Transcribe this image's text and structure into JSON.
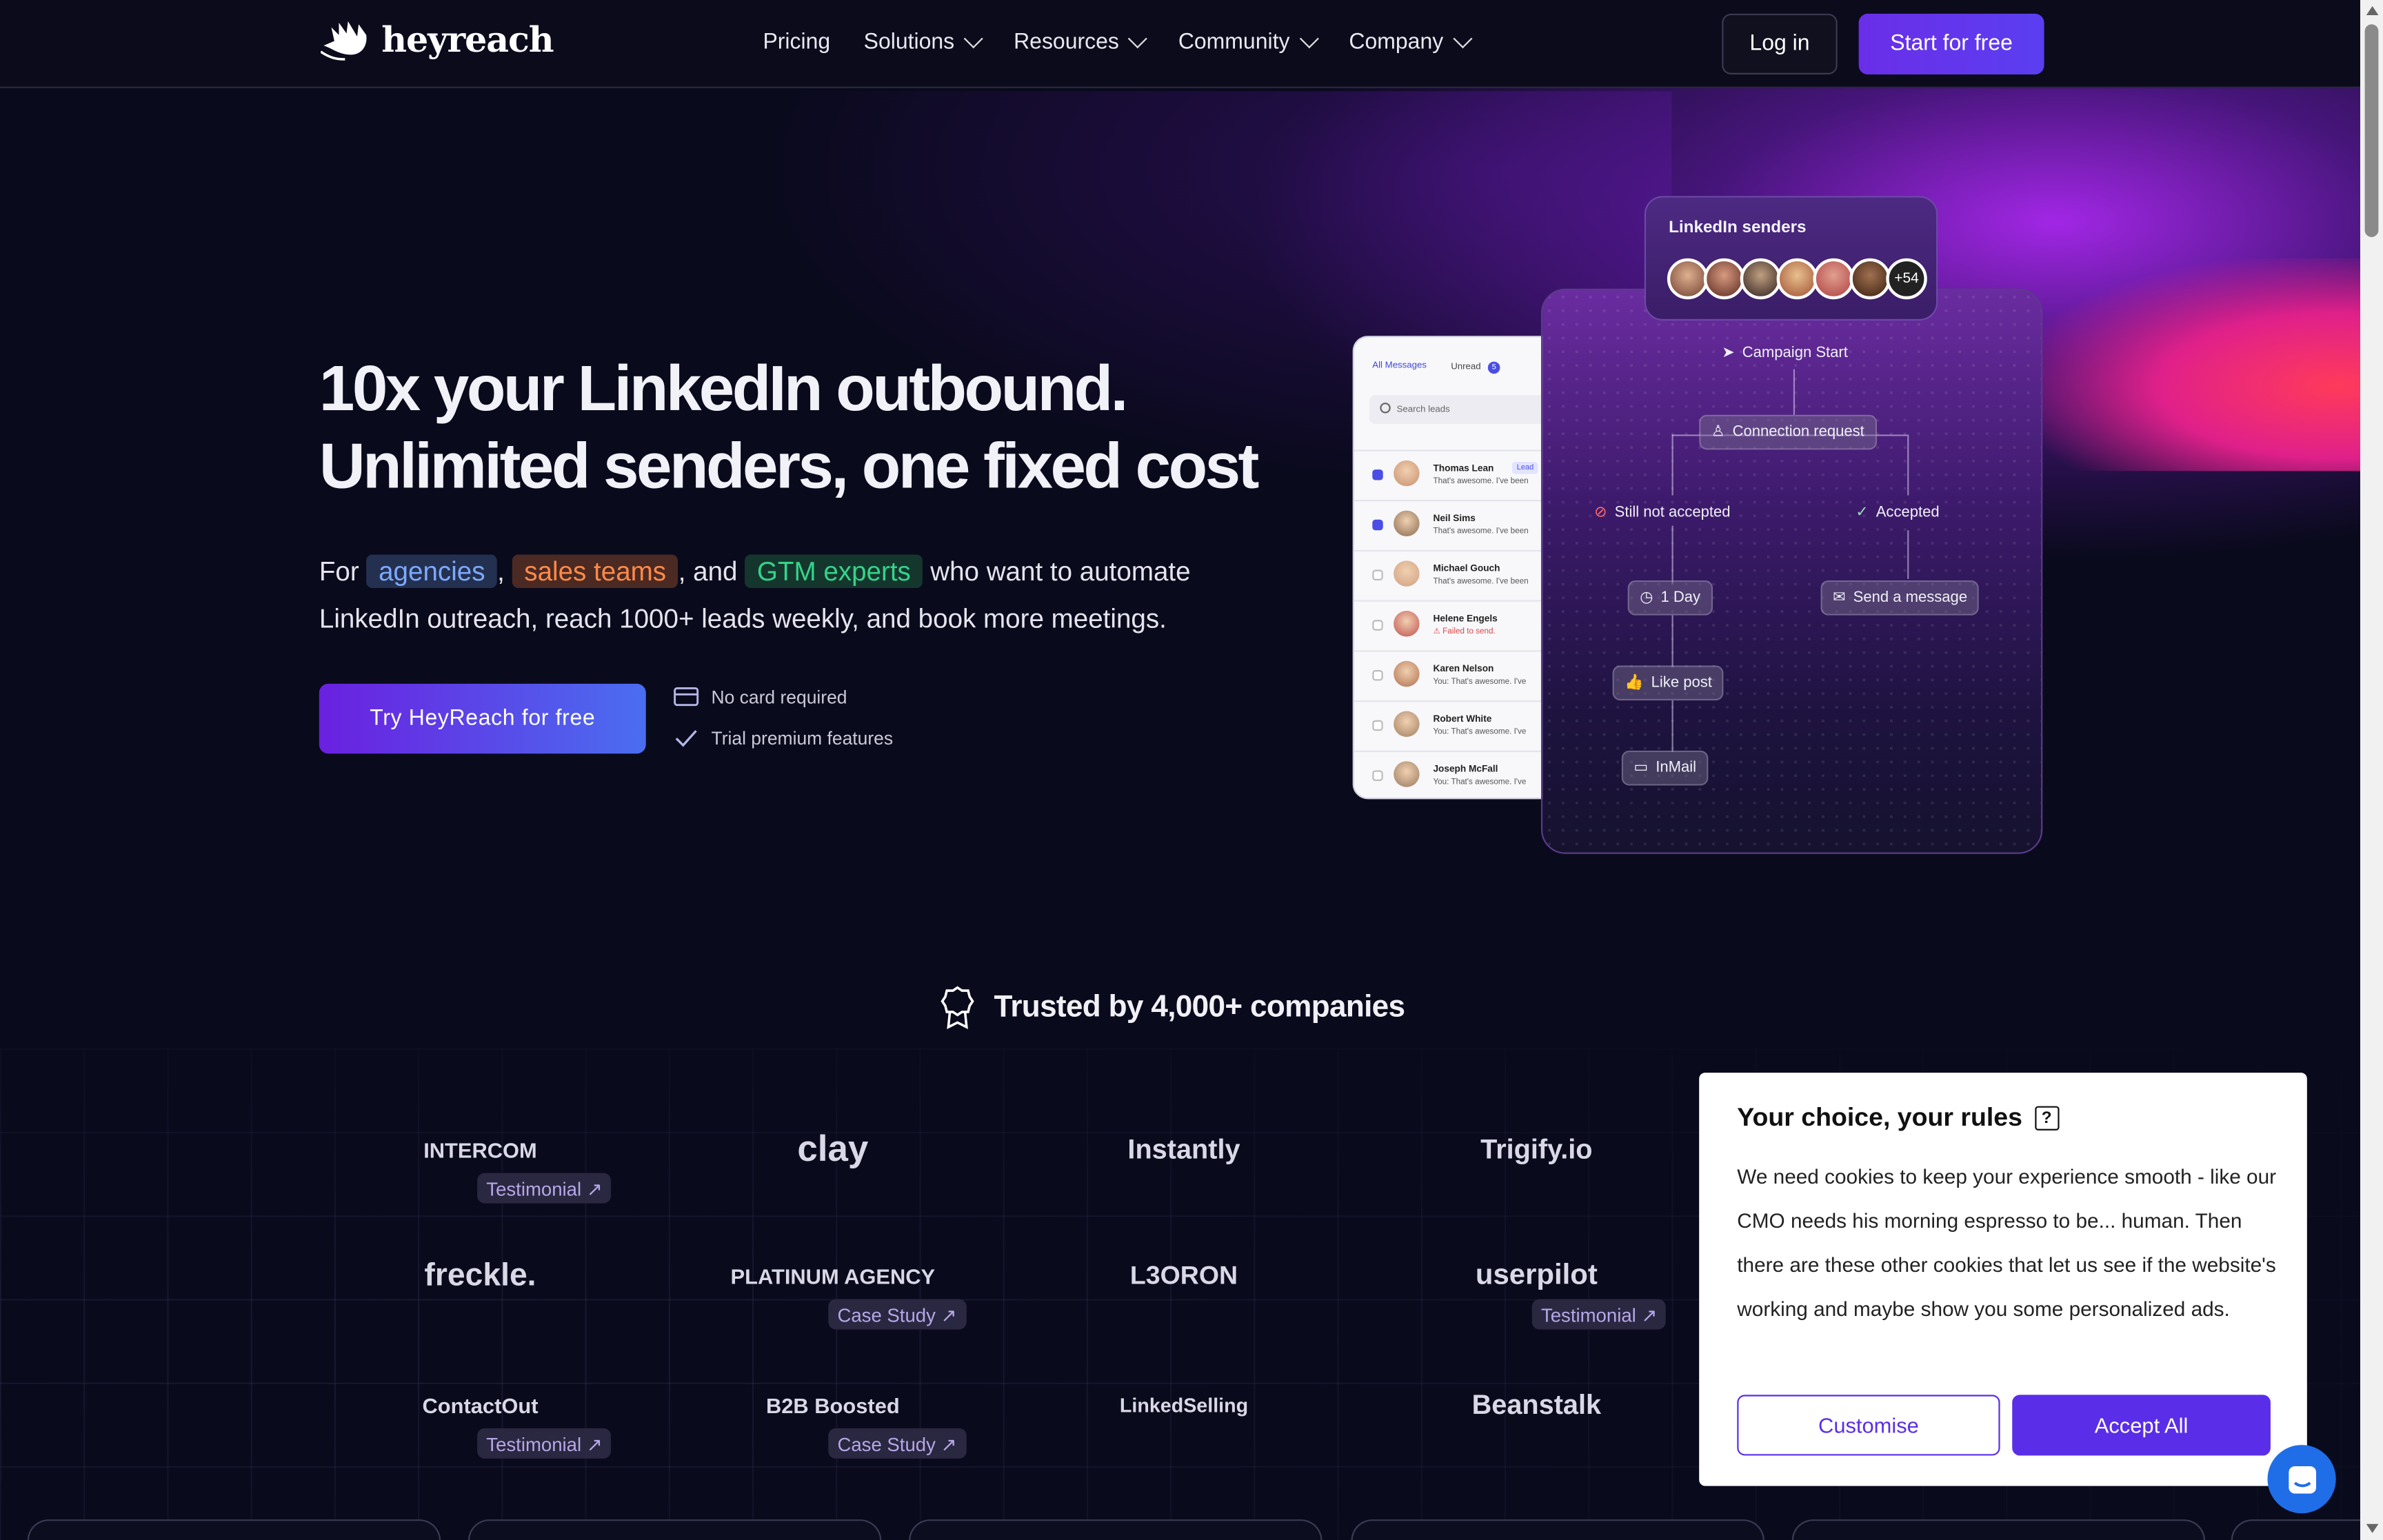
{
  "nav": {
    "brand": "heyreach",
    "items": [
      {
        "label": "Pricing",
        "chevron": false
      },
      {
        "label": "Solutions",
        "chevron": true
      },
      {
        "label": "Resources",
        "chevron": true
      },
      {
        "label": "Community",
        "chevron": true
      },
      {
        "label": "Company",
        "chevron": true
      }
    ],
    "login": "Log in",
    "start": "Start for free"
  },
  "hero": {
    "title_line1": "10x your LinkedIn outbound.",
    "title_line2": "Unlimited senders, one fixed cost",
    "sub_for": "For",
    "tag_agencies": "agencies",
    "comma": ",",
    "tag_sales": "sales teams",
    "and": ", and",
    "tag_gtm": "GTM experts",
    "sub_rest1": "who want to automate",
    "sub_rest2": "LinkedIn outreach, reach 1000+ leads weekly, and book more meetings.",
    "cta": "Try HeyReach for free",
    "perk1": "No card required",
    "perk2": "Trial premium features"
  },
  "inbox": {
    "tab_all": "All Messages",
    "tab_unread": "Unread",
    "unread_count": "5",
    "search": "Search leads",
    "lead_badge": "Lead",
    "rows": [
      {
        "name": "Thomas Lean",
        "msg": "That's awesome. I've been",
        "checked": true,
        "error": false
      },
      {
        "name": "Neil Sims",
        "msg": "That's awesome. I've been",
        "checked": true,
        "error": false
      },
      {
        "name": "Michael Gouch",
        "msg": "That's awesome. I've been",
        "checked": false,
        "error": false
      },
      {
        "name": "Helene Engels",
        "msg": "⚠ Failed to send.",
        "checked": false,
        "error": true
      },
      {
        "name": "Karen Nelson",
        "msg": "You: That's awesome. I've",
        "checked": false,
        "error": false
      },
      {
        "name": "Robert White",
        "msg": "You: That's awesome. I've",
        "checked": false,
        "error": false
      },
      {
        "name": "Joseph McFall",
        "msg": "You: That's awesome. I've",
        "checked": false,
        "error": false
      }
    ]
  },
  "flow": {
    "senders_title": "LinkedIn senders",
    "senders_more": "+54",
    "campaign_start": "Campaign Start",
    "connection_request": "Connection request",
    "still_not_accepted": "Still not accepted",
    "accepted": "Accepted",
    "one_day": "1 Day",
    "send_message": "Send a message",
    "like_post": "Like post",
    "inmail": "InMail"
  },
  "trusted": {
    "title": "Trusted by 4,000+ companies",
    "brands": [
      {
        "name": "INTERCOM",
        "badge": "Testimonial ↗"
      },
      {
        "name": "clay",
        "badge": ""
      },
      {
        "name": "Instantly",
        "badge": ""
      },
      {
        "name": "Trigify.io",
        "badge": ""
      },
      {
        "name": "freckle.",
        "badge": ""
      },
      {
        "name": "PLATINUM AGENCY",
        "badge": "Case Study ↗"
      },
      {
        "name": "L3ORON",
        "badge": ""
      },
      {
        "name": "userpilot",
        "badge": "Testimonial ↗"
      },
      {
        "name": "ContactOut",
        "badge": "Testimonial ↗"
      },
      {
        "name": "B2B Boosted",
        "badge": "Case Study ↗"
      },
      {
        "name": "LinkedSelling",
        "badge": ""
      },
      {
        "name": "Beanstalk",
        "badge": ""
      }
    ]
  },
  "cookie": {
    "title": "Your choice, your rules",
    "q": "?",
    "body": "We need cookies to keep your experience smooth - like our CMO needs his morning espresso to be... human. Then there are these other cookies that let us see if the website's working and maybe show you some personalized ads.",
    "customise": "Customise",
    "accept": "Accept All"
  },
  "colors": {
    "bg": "#0a0a1d",
    "accent": "#5a2ee8",
    "tag_agencies": "#7da9ff",
    "tag_sales": "#ff8a4a",
    "tag_gtm": "#34d48a"
  }
}
